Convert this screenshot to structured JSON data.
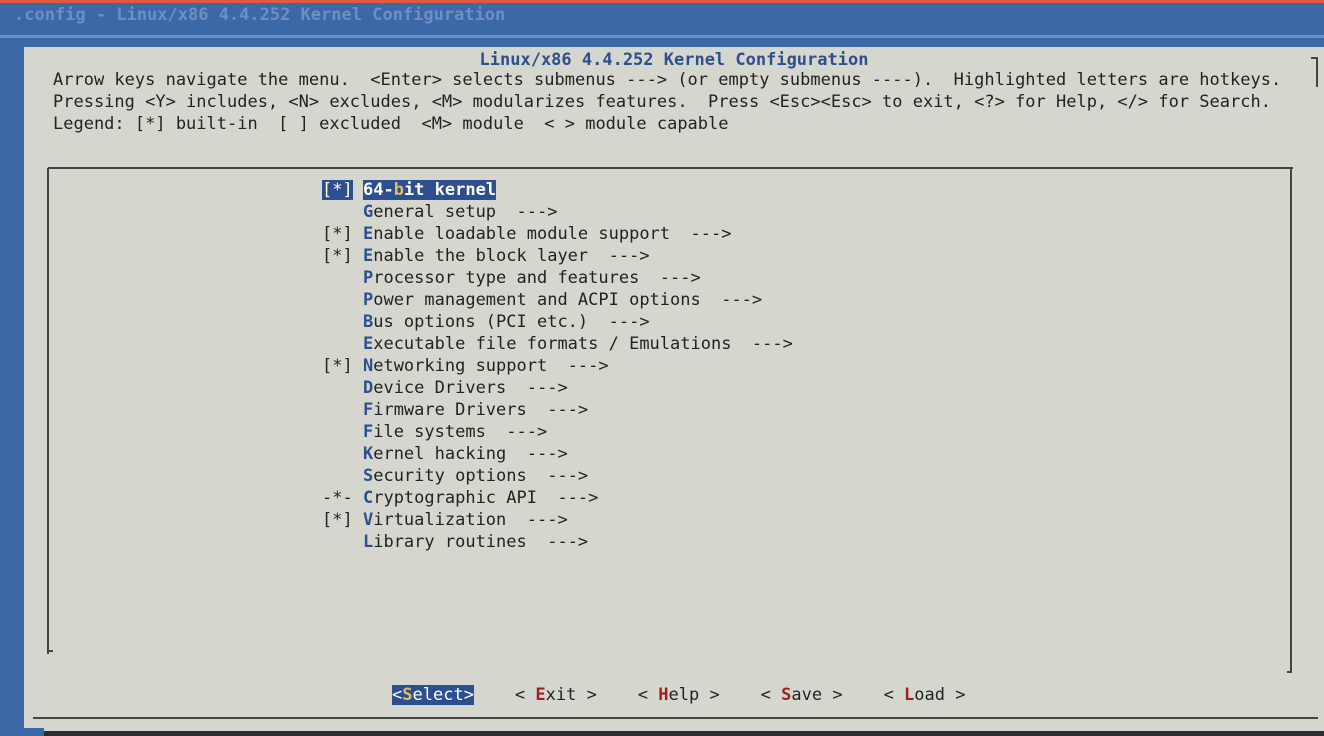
{
  "window": {
    "backtitle": ".config - Linux/x86 4.4.252 Kernel Configuration"
  },
  "dialog": {
    "title": "Linux/x86 4.4.252 Kernel Configuration",
    "help_lines": [
      "Arrow keys navigate the menu.  <Enter> selects submenus ---> (or empty submenus ----).  Highlighted letters are hotkeys.",
      "Pressing <Y> includes, <N> excludes, <M> modularizes features.  Press <Esc><Esc> to exit, <?> for Help, </> for Search.",
      "Legend: [*] built-in  [ ] excluded  <M> module  < > module capable"
    ]
  },
  "menu": {
    "items": [
      {
        "prefix": "[*]",
        "before": "64-",
        "hot": "b",
        "after": "it kernel",
        "suffix": "",
        "selected": true
      },
      {
        "prefix": "   ",
        "before": "",
        "hot": "G",
        "after": "eneral setup",
        "suffix": "  --->",
        "selected": false
      },
      {
        "prefix": "[*]",
        "before": "",
        "hot": "E",
        "after": "nable loadable module support",
        "suffix": "  --->",
        "selected": false
      },
      {
        "prefix": "[*]",
        "before": "",
        "hot": "E",
        "after": "nable the block layer",
        "suffix": "  --->",
        "selected": false
      },
      {
        "prefix": "   ",
        "before": "",
        "hot": "P",
        "after": "rocessor type and features",
        "suffix": "  --->",
        "selected": false
      },
      {
        "prefix": "   ",
        "before": "",
        "hot": "P",
        "after": "ower management and ACPI options",
        "suffix": "  --->",
        "selected": false
      },
      {
        "prefix": "   ",
        "before": "",
        "hot": "B",
        "after": "us options (PCI etc.)",
        "suffix": "  --->",
        "selected": false
      },
      {
        "prefix": "   ",
        "before": "",
        "hot": "E",
        "after": "xecutable file formats / Emulations",
        "suffix": "  --->",
        "selected": false
      },
      {
        "prefix": "[*]",
        "before": "",
        "hot": "N",
        "after": "etworking support",
        "suffix": "  --->",
        "selected": false
      },
      {
        "prefix": "   ",
        "before": "",
        "hot": "D",
        "after": "evice Drivers",
        "suffix": "  --->",
        "selected": false
      },
      {
        "prefix": "   ",
        "before": "",
        "hot": "F",
        "after": "irmware Drivers",
        "suffix": "  --->",
        "selected": false
      },
      {
        "prefix": "   ",
        "before": "",
        "hot": "F",
        "after": "ile systems",
        "suffix": "  --->",
        "selected": false
      },
      {
        "prefix": "   ",
        "before": "",
        "hot": "K",
        "after": "ernel hacking",
        "suffix": "  --->",
        "selected": false
      },
      {
        "prefix": "   ",
        "before": "",
        "hot": "S",
        "after": "ecurity options",
        "suffix": "  --->",
        "selected": false
      },
      {
        "prefix": "-*-",
        "before": "",
        "hot": "C",
        "after": "ryptographic API",
        "suffix": "  --->",
        "selected": false
      },
      {
        "prefix": "[*]",
        "before": "",
        "hot": "V",
        "after": "irtualization",
        "suffix": "  --->",
        "selected": false
      },
      {
        "prefix": "   ",
        "before": "",
        "hot": "L",
        "after": "ibrary routines",
        "suffix": "  --->",
        "selected": false
      }
    ]
  },
  "buttons": [
    {
      "id": "select",
      "open": "<",
      "hot": "S",
      "rest": "elect",
      "close": ">",
      "selected": true
    },
    {
      "id": "exit",
      "open": "< ",
      "hot": "E",
      "rest": "xit",
      "close": " >",
      "selected": false
    },
    {
      "id": "help",
      "open": "< ",
      "hot": "H",
      "rest": "elp",
      "close": " >",
      "selected": false
    },
    {
      "id": "save",
      "open": "< ",
      "hot": "S",
      "rest": "ave",
      "close": " >",
      "selected": false
    },
    {
      "id": "load",
      "open": "< ",
      "hot": "L",
      "rest": "oad",
      "close": " >",
      "selected": false
    }
  ]
}
